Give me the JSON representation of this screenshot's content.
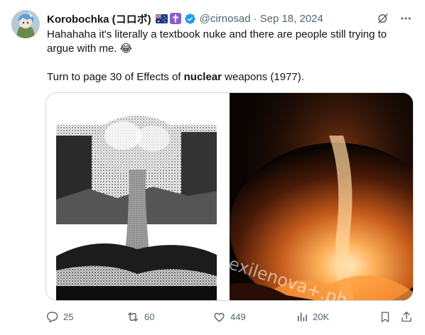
{
  "author": {
    "display_name": "Korobochka (コロボ)",
    "handle": "@cirnosad",
    "separator": "·",
    "date": "Sep 18, 2024",
    "badges": [
      "australia-flag-icon",
      "cross-icon",
      "verified-badge-icon"
    ]
  },
  "tweet": {
    "line1": "Hahahaha it's literally a textbook nuke and there are people still trying to argue with me. 😂",
    "line2_pre": "Turn to page 30 of Effects of ",
    "line2_bold": "nuclear",
    "line2_post": " weapons (1977)."
  },
  "media": {
    "watermark": "exilenova+.ph",
    "left_image": "mushroom-cloud-photo",
    "right_image": "explosion-fire-photo"
  },
  "actions": {
    "replies": "25",
    "reposts": "60",
    "likes": "449",
    "views": "20K"
  },
  "colors": {
    "text_primary": "#0f1419",
    "text_secondary": "#536471",
    "accent": "#1d9bf0",
    "border": "#cfd9de"
  }
}
